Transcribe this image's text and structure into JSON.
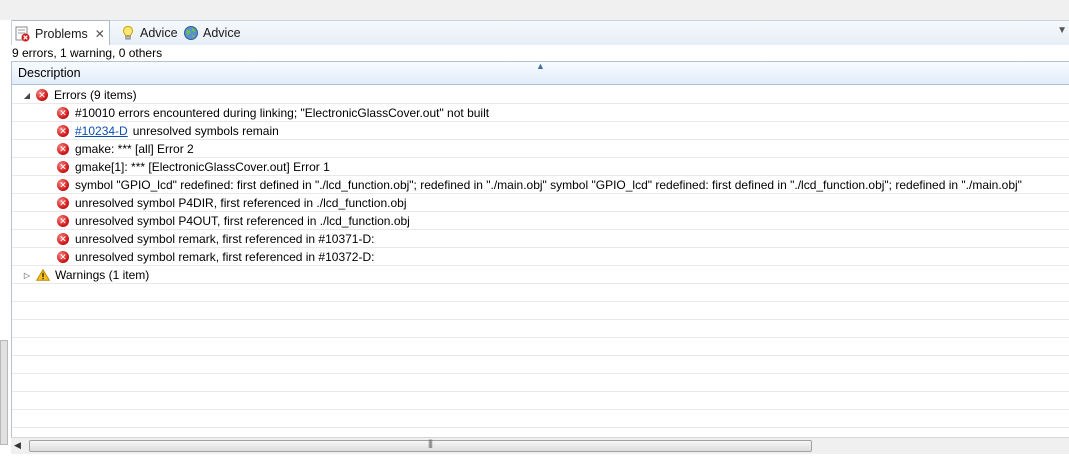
{
  "tabs": [
    {
      "label": "Problems",
      "icon": "problems-icon",
      "active": true,
      "closable": true
    },
    {
      "label": "Advice",
      "icon": "lightbulb-icon",
      "active": false
    },
    {
      "label": "Advice",
      "icon": "globe-icon",
      "active": false
    }
  ],
  "summary": "9 errors, 1 warning, 0 others",
  "column_header": "Description",
  "errors_group": {
    "label": "Errors (9 items)",
    "expanded": true,
    "items": [
      {
        "text": "#10010 errors encountered during linking; \"ElectronicGlassCover.out\" not built"
      },
      {
        "link": "#10234-D",
        "text": "unresolved symbols remain"
      },
      {
        "text": "gmake: *** [all] Error 2"
      },
      {
        "text": "gmake[1]: *** [ElectronicGlassCover.out] Error 1"
      },
      {
        "text": "symbol \"GPIO_lcd\" redefined: first defined in \"./lcd_function.obj\"; redefined in \"./main.obj\" symbol \"GPIO_lcd\" redefined: first defined in \"./lcd_function.obj\"; redefined in \"./main.obj\""
      },
      {
        "text": "unresolved symbol P4DIR, first referenced in ./lcd_function.obj"
      },
      {
        "text": "unresolved symbol P4OUT, first referenced in ./lcd_function.obj"
      },
      {
        "text": "unresolved symbol remark, first referenced in #10371-D:"
      },
      {
        "text": "unresolved symbol remark, first referenced in #10372-D:"
      }
    ]
  },
  "warnings_group": {
    "label": "Warnings (1 item)",
    "expanded": false
  },
  "colors": {
    "error": "#d21b1b",
    "warning": "#f2b500",
    "link": "#0b4fb3",
    "header_border": "#a9c2dc"
  }
}
